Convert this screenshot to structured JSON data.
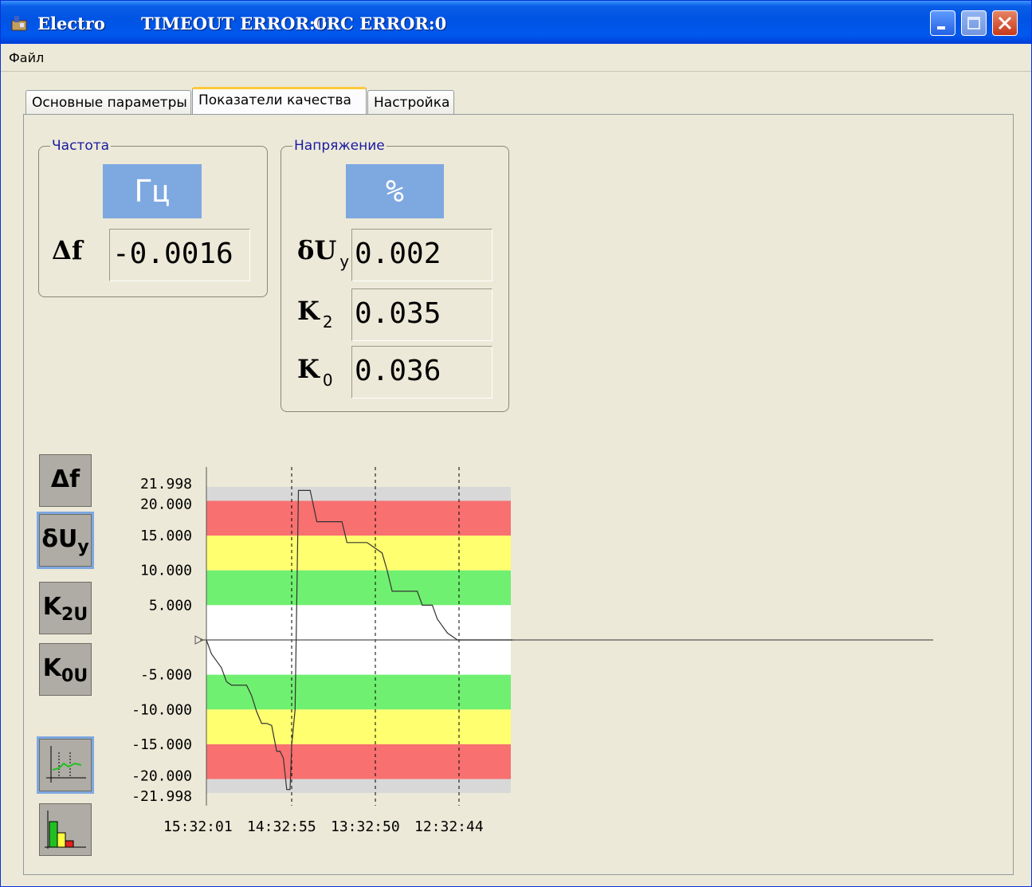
{
  "window": {
    "app_title": "Electro",
    "timeout_status": "TIMEOUT ERROR:0",
    "crc_status": "CRC ERROR:0"
  },
  "menu": {
    "file": "Файл"
  },
  "tabs": [
    {
      "label": "Основные параметры",
      "active": false
    },
    {
      "label": "Показатели качества",
      "active": true
    },
    {
      "label": "Настройка",
      "active": false
    }
  ],
  "frequency": {
    "group_title": "Частота",
    "unit": "Гц",
    "delta_f_label": "Δf",
    "delta_f_value": "-0.0016"
  },
  "voltage": {
    "group_title": "Напряжение",
    "unit": "%",
    "du_label": "δU",
    "du_sub": "у",
    "du_value": "0.002",
    "k2_label": "K",
    "k2_sub": "2",
    "k2_value": "0.035",
    "k0_label": "K",
    "k0_sub": "0",
    "k0_value": "0.036"
  },
  "side_buttons": [
    {
      "label": "Δf",
      "selected": false
    },
    {
      "label": "δU",
      "sub": "y",
      "selected": true
    },
    {
      "label": "K",
      "sub": "2U",
      "selected": false
    },
    {
      "label": "K",
      "sub": "0U",
      "selected": false
    }
  ],
  "view_buttons": [
    {
      "icon": "trend-chart-icon",
      "selected": true
    },
    {
      "icon": "histogram-icon",
      "selected": false
    }
  ],
  "colors": {
    "red_band": "#f87070",
    "yellow_band": "#ffff70",
    "green_band": "#70f070",
    "gray_band": "#d8d8d8",
    "unit_box": "#7ea8e0"
  },
  "chart_data": {
    "type": "line",
    "y_tick_labels": [
      "21.998",
      "20.000",
      "15.000",
      "10.000",
      "5.000",
      "-5.000",
      "-10.000",
      "-15.000",
      "-20.000",
      "-21.998"
    ],
    "y_tick_values": [
      21.998,
      20,
      15,
      10,
      5,
      -5,
      -10,
      -15,
      -20,
      -21.998
    ],
    "x_tick_labels": [
      "15:32:01",
      "14:32:55",
      "13:32:50",
      "12:32:44"
    ],
    "ylim": [
      -21.998,
      21.998
    ],
    "bands": [
      {
        "from": 20,
        "to": 21.998,
        "color": "gray"
      },
      {
        "from": 15,
        "to": 20,
        "color": "red"
      },
      {
        "from": 10,
        "to": 15,
        "color": "yellow"
      },
      {
        "from": 5,
        "to": 10,
        "color": "green"
      },
      {
        "from": -5,
        "to": 5,
        "color": "white"
      },
      {
        "from": -10,
        "to": -5,
        "color": "green"
      },
      {
        "from": -15,
        "to": -10,
        "color": "yellow"
      },
      {
        "from": -20,
        "to": -15,
        "color": "red"
      },
      {
        "from": -21.998,
        "to": -20,
        "color": "gray"
      }
    ],
    "series": [
      {
        "x": [
          0,
          0.06,
          0.12,
          0.18,
          0.24,
          0.3,
          0.36,
          0.42,
          0.48,
          0.54,
          0.6,
          0.66,
          0.72,
          0.78,
          0.84,
          0.88,
          0.92,
          0.96,
          1.0,
          1.02,
          1.06,
          1.1,
          1.16,
          1.24,
          1.32,
          1.4,
          1.48,
          1.56,
          1.62,
          1.68,
          1.74,
          1.8,
          1.86,
          1.92,
          1.98,
          2.04,
          2.1,
          2.16,
          2.22,
          2.28,
          2.34,
          2.4,
          2.46,
          2.52,
          2.58,
          2.64,
          2.7,
          2.76,
          2.82,
          2.88,
          2.94,
          3.0,
          3.06,
          3.12,
          3.18,
          3.24,
          3.3,
          3.36,
          3.42,
          3.48,
          3.54,
          3.6,
          3.66
        ],
        "y": [
          0,
          -2,
          -3,
          -4,
          -6,
          -6.5,
          -6.5,
          -6.5,
          -6.5,
          -8,
          -10.3,
          -12,
          -12,
          -12.3,
          -16,
          -16,
          -17,
          -21.5,
          -21.5,
          -15,
          -10,
          21.5,
          21.5,
          21.5,
          17,
          17,
          17,
          17,
          17,
          14,
          14,
          14,
          14,
          14,
          13.5,
          13,
          12.5,
          10,
          7,
          7,
          7,
          7,
          7,
          7,
          5,
          5,
          5,
          3,
          2,
          1,
          0.5,
          0,
          0,
          0,
          0,
          0,
          0,
          0,
          0,
          0,
          0,
          0,
          0
        ]
      }
    ]
  }
}
